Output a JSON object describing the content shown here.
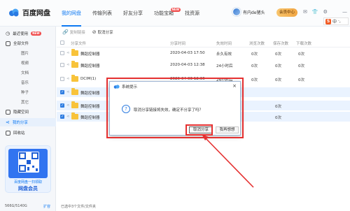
{
  "app": {
    "name": "百度网盘"
  },
  "nav": [
    {
      "label": "我的网盘",
      "active": true
    },
    {
      "label": "传输列表"
    },
    {
      "label": "好友分享"
    },
    {
      "label": "功能宝箱",
      "badge": "NEW"
    },
    {
      "label": "找资源"
    }
  ],
  "user": {
    "name": "有内de猪头",
    "vip_button": "会员中心"
  },
  "ime": {
    "label": "中"
  },
  "sidebar": {
    "items": [
      {
        "label": "最近使用",
        "badge": "NEW"
      },
      {
        "label": "全部文件"
      },
      {
        "label": "图片",
        "sub": true
      },
      {
        "label": "视频",
        "sub": true
      },
      {
        "label": "文档",
        "sub": true
      },
      {
        "label": "音乐",
        "sub": true
      },
      {
        "label": "种子",
        "sub": true
      },
      {
        "label": "其它",
        "sub": true
      },
      {
        "label": "隐藏空间"
      },
      {
        "label": "我的分享",
        "active": true
      },
      {
        "label": "回收站"
      }
    ],
    "promo": {
      "caption": "百度网盘一扫领取",
      "title": "网盘会员"
    },
    "storage": {
      "text": "566G/5140G",
      "link": "扩容"
    }
  },
  "toolbar": {
    "copy_link": "复制链接",
    "cancel_share": "取消分享"
  },
  "table": {
    "columns": [
      "分享文件",
      "分享时间",
      "失效时间",
      "浏览次数",
      "保存次数",
      "下载次数"
    ],
    "rows": [
      {
        "name": "舞蹈控制器",
        "share_time": "2020-04-03 17:50",
        "expire": "永久有效",
        "views": "0次",
        "saves": "0次",
        "downloads": "0次",
        "checked": false
      },
      {
        "name": "舞蹈控制器",
        "share_time": "2020-04-03 12:38",
        "expire": "24小时后",
        "views": "0次",
        "saves": "0次",
        "downloads": "0次",
        "checked": false
      },
      {
        "name": "DCIM(1)",
        "share_time": "2020-04-03 12:36",
        "expire": "24小时后",
        "views": "0次",
        "saves": "0次",
        "downloads": "0次",
        "checked": false
      },
      {
        "name": "舞蹈控制器",
        "share_time": "",
        "expire": "",
        "views": "",
        "saves": "",
        "downloads": "",
        "checked": true
      },
      {
        "name": "舞蹈控制器",
        "share_time": "",
        "expire": "",
        "views": "",
        "saves": "0次",
        "downloads": "",
        "checked": true
      },
      {
        "name": "舞蹈控制器",
        "share_time": "",
        "expire": "",
        "views": "",
        "saves": "0次",
        "downloads": "",
        "checked": true
      }
    ]
  },
  "status": {
    "text": "已选中3个文件/文件夹"
  },
  "dialog": {
    "title": "系统提示",
    "message": "取消分享链接将失效，确定不分享了吗？",
    "confirm": "取消分享",
    "cancel": "我再想想"
  },
  "colors": {
    "accent": "#0d78f2",
    "annotation": "#e53030"
  }
}
